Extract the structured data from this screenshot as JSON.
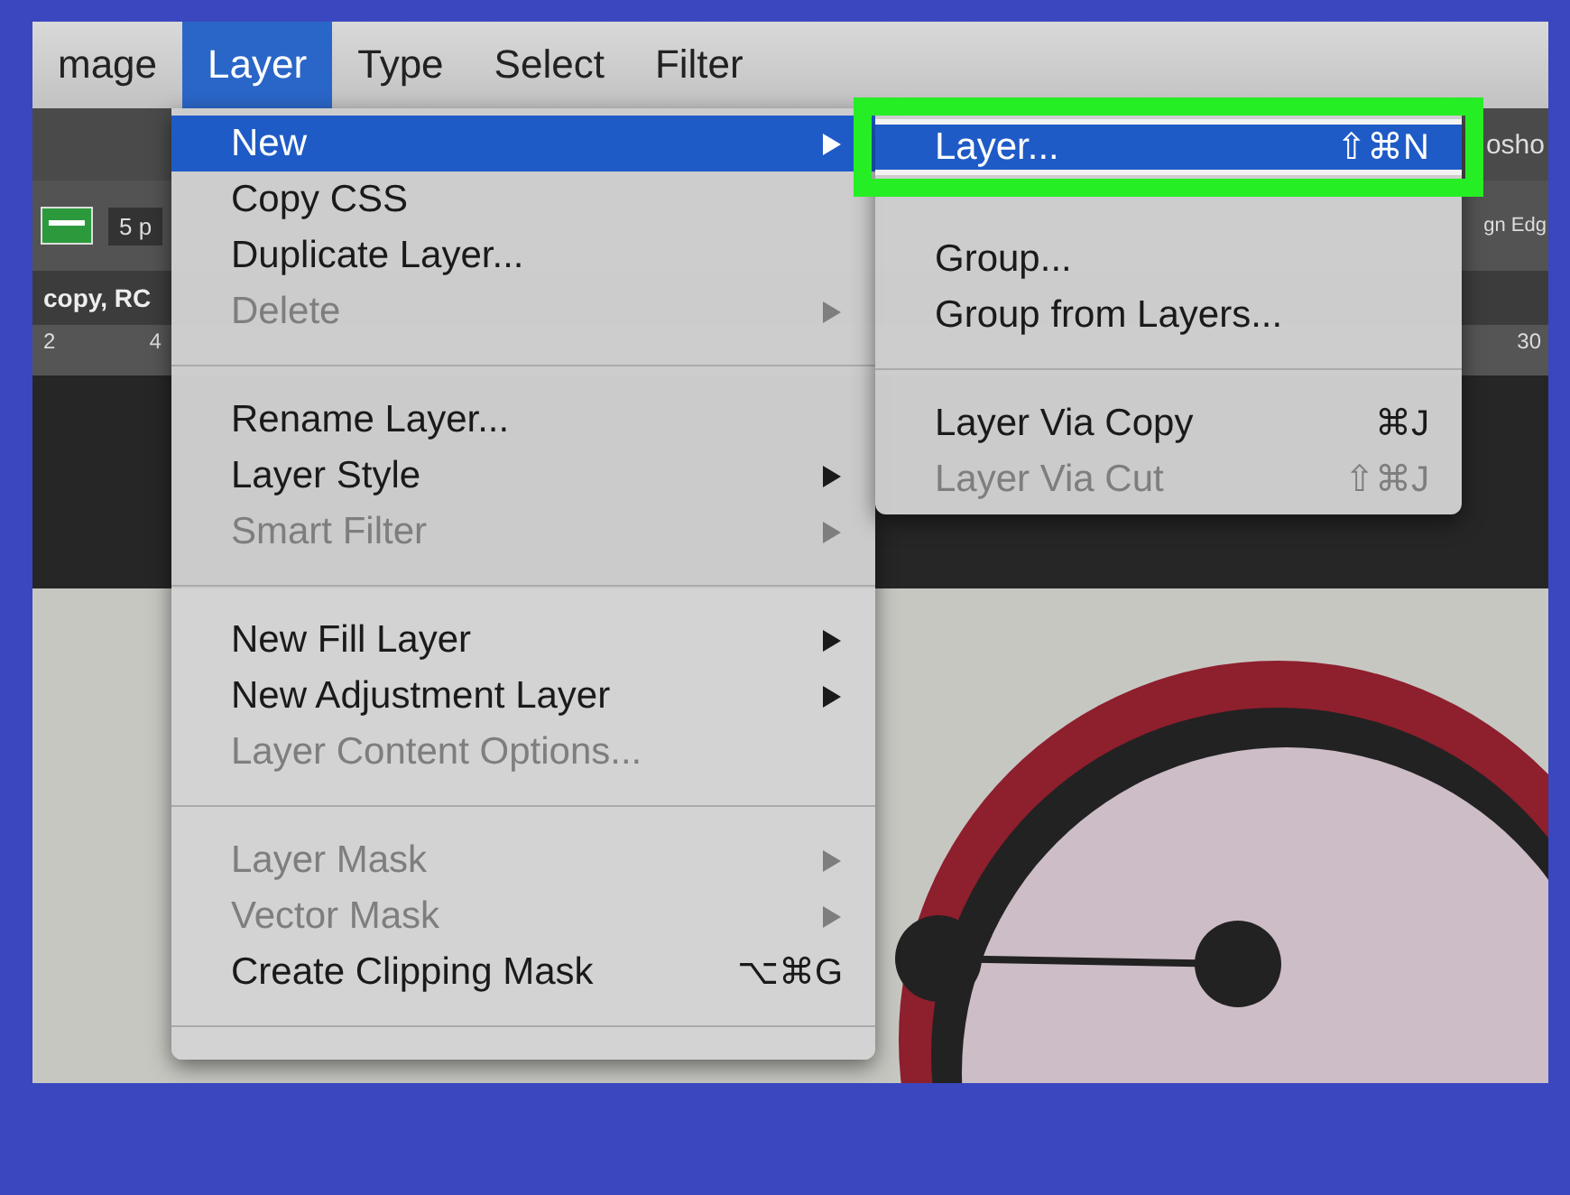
{
  "menubar": {
    "items": [
      {
        "label": "mage",
        "selected": false
      },
      {
        "label": "Layer",
        "selected": true
      },
      {
        "label": "Type",
        "selected": false
      },
      {
        "label": "Select",
        "selected": false
      },
      {
        "label": "Filter",
        "selected": false
      }
    ]
  },
  "background": {
    "title_fragment": "osho",
    "options_fragment": "5 p",
    "options_fragment_right": "gn Edg",
    "document_tab": "copy, RC",
    "ruler_ticks": [
      "2",
      "4",
      "30"
    ]
  },
  "layer_menu": {
    "sections": [
      [
        {
          "label": "New",
          "submenu": true,
          "disabled": false,
          "selected": true
        },
        {
          "label": "Copy CSS",
          "submenu": false,
          "disabled": false,
          "selected": false
        },
        {
          "label": "Duplicate Layer...",
          "submenu": false,
          "disabled": false,
          "selected": false
        },
        {
          "label": "Delete",
          "submenu": true,
          "disabled": true,
          "selected": false
        }
      ],
      [
        {
          "label": "Rename Layer...",
          "submenu": false,
          "disabled": false,
          "selected": false
        },
        {
          "label": "Layer Style",
          "submenu": true,
          "disabled": false,
          "selected": false
        },
        {
          "label": "Smart Filter",
          "submenu": true,
          "disabled": true,
          "selected": false
        }
      ],
      [
        {
          "label": "New Fill Layer",
          "submenu": true,
          "disabled": false,
          "selected": false
        },
        {
          "label": "New Adjustment Layer",
          "submenu": true,
          "disabled": false,
          "selected": false
        },
        {
          "label": "Layer Content Options...",
          "submenu": false,
          "disabled": true,
          "selected": false
        }
      ],
      [
        {
          "label": "Layer Mask",
          "submenu": true,
          "disabled": true,
          "selected": false
        },
        {
          "label": "Vector Mask",
          "submenu": true,
          "disabled": true,
          "selected": false
        },
        {
          "label": "Create Clipping Mask",
          "shortcut": "⌥⌘G",
          "submenu": false,
          "disabled": false,
          "selected": false
        }
      ]
    ]
  },
  "new_submenu": {
    "sections": [
      [
        {
          "label": "Layer...",
          "shortcut": "⇧⌘N",
          "disabled": false,
          "selected": true,
          "highlighted": true
        },
        {
          "label": "Group...",
          "disabled": false,
          "selected": false,
          "highlighted": false
        },
        {
          "label": "Group from Layers...",
          "disabled": false,
          "selected": false,
          "highlighted": false
        }
      ],
      [
        {
          "label": "Layer Via Copy",
          "shortcut": "⌘J",
          "disabled": false,
          "selected": false,
          "highlighted": false
        },
        {
          "label": "Layer Via Cut",
          "shortcut": "⇧⌘J",
          "disabled": true,
          "selected": false,
          "highlighted": false
        }
      ]
    ]
  }
}
